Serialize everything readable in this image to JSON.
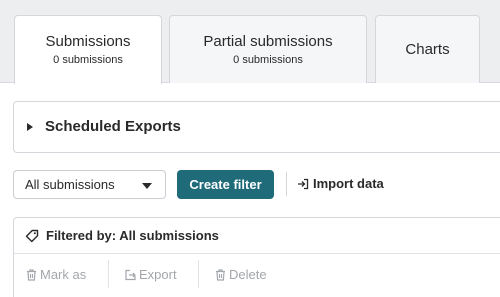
{
  "tabs": [
    {
      "title": "Submissions",
      "subtitle": "0 submissions",
      "active": true
    },
    {
      "title": "Partial submissions",
      "subtitle": "0 submissions",
      "active": false
    },
    {
      "title": "Charts",
      "active": false
    }
  ],
  "scheduled_exports": {
    "label": "Scheduled Exports",
    "icon": "caret-right-icon"
  },
  "toolbar": {
    "filter_select": {
      "value": "All submissions",
      "icon": "chevron-down-icon"
    },
    "create_filter_label": "Create filter",
    "import_label": "Import data",
    "import_icon": "import-icon"
  },
  "filter_panel": {
    "label": "Filtered by: All submissions",
    "icon": "tag-icon",
    "actions": [
      {
        "label": "Mark as",
        "icon": "trash-icon"
      },
      {
        "label": "Export",
        "icon": "export-icon"
      },
      {
        "label": "Delete",
        "icon": "trash-icon"
      }
    ]
  },
  "colors": {
    "primary": "#1f6b7a",
    "tabbar_bg": "#eceef0",
    "disabled_text": "#a3a7ac"
  }
}
